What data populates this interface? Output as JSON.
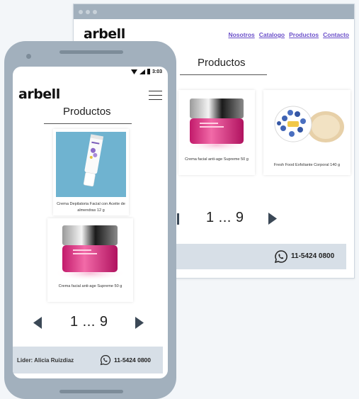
{
  "desktop": {
    "logo": "arbell",
    "nav": [
      "Nosotros",
      "Catalogo",
      "Productos",
      "Contacto"
    ],
    "title": "Productos",
    "products": [
      {
        "caption": "Crema facial anti-age Supreme 50 g"
      },
      {
        "caption": "Fresh Food Exfoliante Corporal 140 g"
      }
    ],
    "pager": "1 ... 9",
    "phone": "11-5424 0800"
  },
  "mobile": {
    "status_time": "3:03",
    "logo": "arbell",
    "title": "Productos",
    "products": [
      {
        "caption": "Crema Depilatoria Facial con Aceite de almendras 12 g"
      },
      {
        "caption": "Crema facial anti-age Supreme 50 g"
      }
    ],
    "pager": "1 ... 9",
    "leader": "Lider: Alicia Ruizdiaz",
    "phone": "11-5424 0800"
  },
  "colors": {
    "device_frame": "#a2b0bd",
    "footer_bg": "#d7dfe7",
    "nav_link": "#6a4fc9",
    "arrow": "#3b4856"
  }
}
